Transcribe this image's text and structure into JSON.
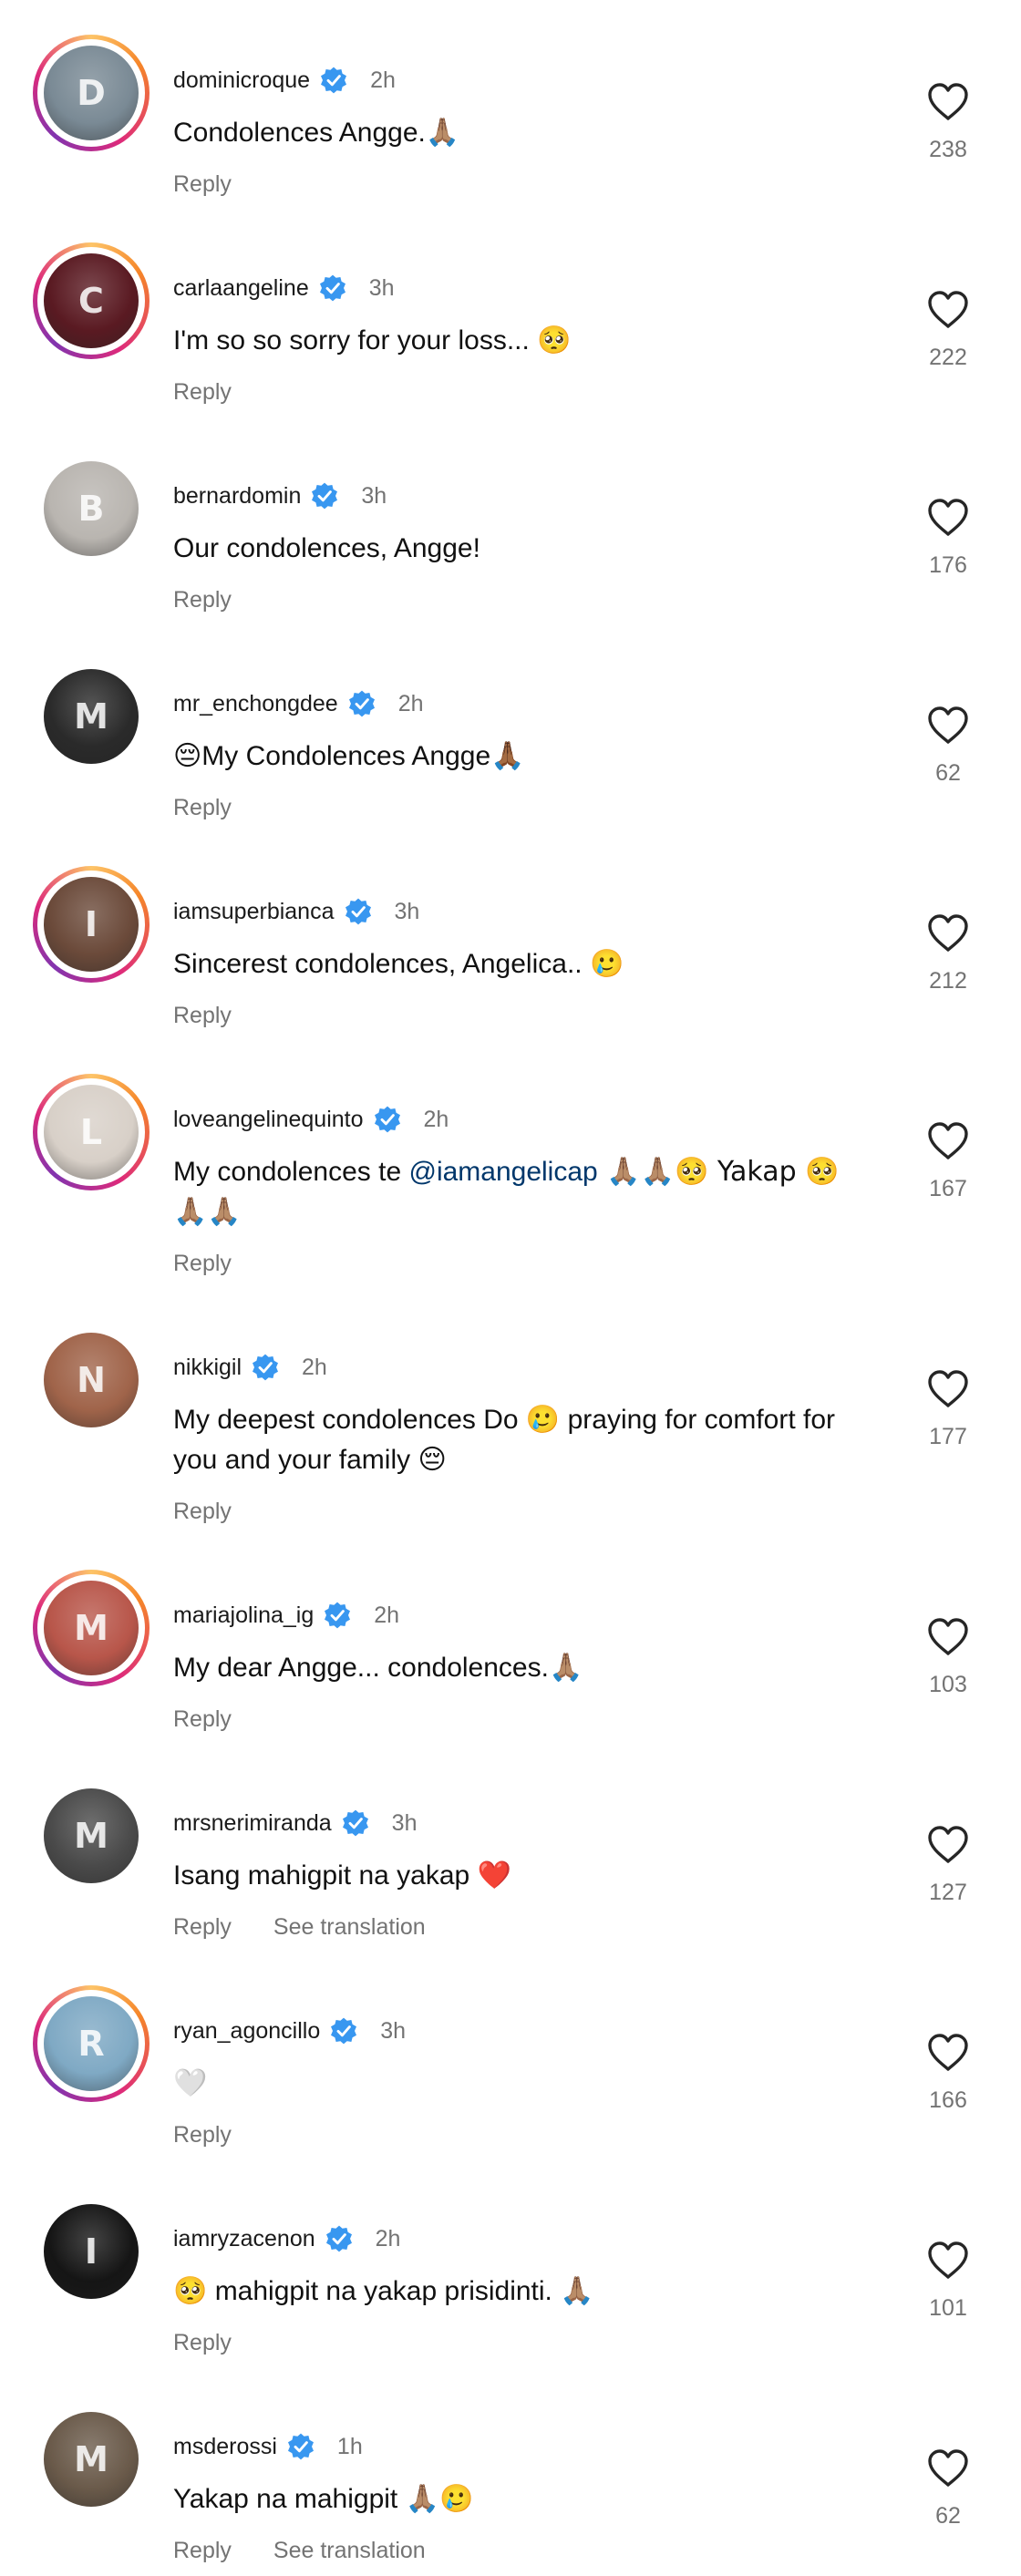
{
  "accent_colors": {
    "verified": "#3897f0",
    "mention": "#00376b",
    "muted": "#737373"
  },
  "comments": [
    {
      "username": "dominicroque",
      "time": "2h",
      "text": "Condolences Angge.",
      "emoji": "🙏🏽",
      "reply": "Reply",
      "likes": "238",
      "story": true,
      "avatar_color": "#7a8a95"
    },
    {
      "username": "carlaangeline",
      "time": "3h",
      "text": "I'm so so sorry for your loss... ",
      "emoji": "🥺",
      "reply": "Reply",
      "likes": "222",
      "story": true,
      "avatar_color": "#5a1a22"
    },
    {
      "username": "bernardomin",
      "time": "3h",
      "text": "Our condolences, Angge!",
      "emoji": "",
      "reply": "Reply",
      "likes": "176",
      "story": false,
      "avatar_color": "#b9b5b0"
    },
    {
      "username": "mr_enchongdee",
      "time": "2h",
      "emoji_before": "😔",
      "text": "My Condolences Angge",
      "emoji": "🙏🏾",
      "reply": "Reply",
      "likes": "62",
      "story": false,
      "avatar_color": "#2a2a2a"
    },
    {
      "username": "iamsuperbianca",
      "time": "3h",
      "text": "Sincerest condolences, Angelica.. ",
      "emoji": "🥲",
      "reply": "Reply",
      "likes": "212",
      "story": true,
      "avatar_color": "#6b4a3a"
    },
    {
      "username": "loveangelinequinto",
      "time": "2h",
      "text": "My condolences te ",
      "mention": "@iamangelicap",
      "text_after": " 🙏🏽🙏🏽🥺 Yakap 🥺 🙏🏽🙏🏽",
      "reply": "Reply",
      "likes": "167",
      "story": true,
      "avatar_color": "#d8d0c8"
    },
    {
      "username": "nikkigil",
      "time": "2h",
      "text": "My deepest condolences Do 🥲 praying for comfort for you and your family ",
      "emoji": "😔",
      "reply": "Reply",
      "likes": "177",
      "story": false,
      "avatar_color": "#a0644a"
    },
    {
      "username": "mariajolina_ig",
      "time": "2h",
      "text": "My dear Angge... condolences.",
      "emoji": "🙏🏽",
      "reply": "Reply",
      "likes": "103",
      "story": true,
      "avatar_color": "#b8564a"
    },
    {
      "username": "mrsnerimiranda",
      "time": "3h",
      "text": "Isang mahigpit na yakap ",
      "emoji": "❤️",
      "reply": "Reply",
      "translate": "See translation",
      "likes": "127",
      "story": false,
      "avatar_color": "#4a4a4a"
    },
    {
      "username": "ryan_agoncillo",
      "time": "3h",
      "text": "",
      "emoji": "🤍",
      "reply": "Reply",
      "likes": "166",
      "story": true,
      "avatar_color": "#7fa9c4"
    },
    {
      "username": "iamryzacenon",
      "time": "2h",
      "emoji_before": "🥺",
      "text": " mahigpit na yakap prisidinti. ",
      "emoji": "🙏🏽",
      "reply": "Reply",
      "likes": "101",
      "story": false,
      "avatar_color": "#151515"
    },
    {
      "username": "msderossi",
      "time": "1h",
      "text": "Yakap na mahigpit ",
      "emoji": "🙏🏽🥲",
      "reply": "Reply",
      "translate": "See translation",
      "likes": "62",
      "story": false,
      "avatar_color": "#6a5a4a"
    }
  ]
}
